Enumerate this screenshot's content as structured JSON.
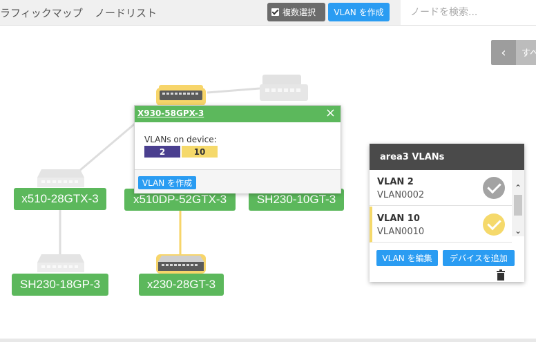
{
  "topbar": {
    "tab_traffic_map": "ラフィックマップ",
    "tab_node_list": "ノードリスト",
    "multi_select_label": "複数選択",
    "create_vlan_label": "VLAN を作成",
    "search_placeholder": "ノードを検索..."
  },
  "right_panel": {
    "collapse_icon": "chevron-left-icon",
    "collapse_glyph": "‹",
    "all_label": "すべ"
  },
  "nodes": [
    {
      "name": "x510-28GTX-3",
      "state": "normal"
    },
    {
      "name": "x510DP-52GTX-3",
      "state": "normal"
    },
    {
      "name": "SH230-10GT-3",
      "state": "normal"
    },
    {
      "name": "SH230-18GP-3",
      "state": "normal"
    },
    {
      "name": "x230-28GT-3",
      "state": "selected"
    },
    {
      "name": "X930-58GPX-3",
      "state": "selected"
    }
  ],
  "popup": {
    "title": "X930-58GPX-3",
    "close_glyph": "×",
    "subtitle": "VLANs on device:",
    "vlans": [
      "2",
      "10"
    ],
    "create_label": "VLAN を作成"
  },
  "vlan_panel": {
    "title": "area3 VLANs",
    "items": [
      {
        "name": "VLAN 2",
        "id": "VLAN0002",
        "active": false
      },
      {
        "name": "VLAN 10",
        "id": "VLAN0010",
        "active": true
      }
    ],
    "scroll_up_glyph": "⌃",
    "scroll_down_glyph": "⌄",
    "edit_label": "VLAN を編集",
    "add_device_label": "デバイスを追加"
  },
  "colors": {
    "node_green": "#5cb85c",
    "accent_blue": "#2a9cf2",
    "vlan2_purple": "#4a3f8f",
    "vlan10_yellow": "#f5d96b",
    "check_gray": "#a3a3a3",
    "check_yellow": "#f5d96b"
  }
}
